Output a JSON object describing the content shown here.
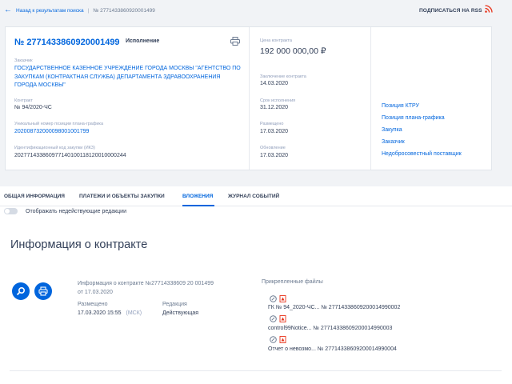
{
  "breadcrumb": {
    "back_label": "Назад к результатам поиска",
    "separator": "|",
    "current": "№ 27714338609200014​99"
  },
  "header": {
    "rss_label": "ПОДПИСАТЬСЯ НА RSS"
  },
  "card": {
    "reg_number": "№ 2771433860920001499",
    "status": "Исполнение",
    "customer_label": "Заказчик",
    "customer_value": "ГОСУДАРСТВЕННОЕ КАЗЕННОЕ УЧРЕЖДЕНИЕ ГОРОДА МОСКВЫ \"АГЕНТСТВО ПО ЗАКУПКАМ (КОНТРАКТНАЯ СЛУЖБА) ДЕПАРТАМЕНТА ЗДРАВООХРАНЕНИЯ ГОРОДА МОСКВЫ\"",
    "contract_label": "Контракт",
    "contract_value": "№ 94/2020-ЧС",
    "plan_label": "Уникальный номер позиции плана-графика",
    "plan_value": "202008732000098001001799",
    "ikz_label": "Идентификационный код закупки (ИКЗ)",
    "ikz_value": "202771433860977140100118120010000244",
    "price_label": "Цена контракта",
    "price_value": "192 000 000,00 ₽",
    "conclusion_label": "Заключение контракта",
    "conclusion_value": "14.03.2020",
    "term_label": "Срок исполнения",
    "term_value": "31.12.2020",
    "placed_label": "Размещено",
    "placed_value": "17.03.2020",
    "updated_label": "Обновление",
    "updated_value": "17.03.2020",
    "quick_links": [
      "Позиция КТРУ",
      "Позиция плана-графика",
      "Закупка",
      "Заказчик",
      "Недобросовестный поставщик"
    ]
  },
  "tabs": [
    "ОБЩАЯ ИНФОРМАЦИЯ",
    "ПЛАТЕЖИ И ОБЪЕКТЫ ЗАКУПКИ",
    "ВЛОЖЕНИЯ",
    "ЖУРНАЛ СОБЫТИЙ"
  ],
  "active_tab": "ВЛОЖЕНИЯ",
  "toggle_label": "Отображать недействующие редакции",
  "section": {
    "title": "Информация о контракте",
    "info_line1": "Информация о контракте №27714338609 20 001499",
    "info_line2": "от 17.03.2020",
    "placed_label": "Размещено",
    "placed_value": "17.03.2020 15:55",
    "tz": "(МСК)",
    "edition_label": "Редакция",
    "edition_value": "Действующая",
    "attachments_title": "Прикрепленные файлы",
    "files": [
      "ГК № 94_2020-ЧС... № 2771433860920001499000​2",
      "control99Notice... № 27714338609200014990003",
      "Отчет о невозмо... № 27714338609200014990004"
    ]
  },
  "colors": {
    "accent": "#0065dd",
    "pdf": "#e8331b",
    "text": "#334059",
    "muted": "#909ebb"
  }
}
